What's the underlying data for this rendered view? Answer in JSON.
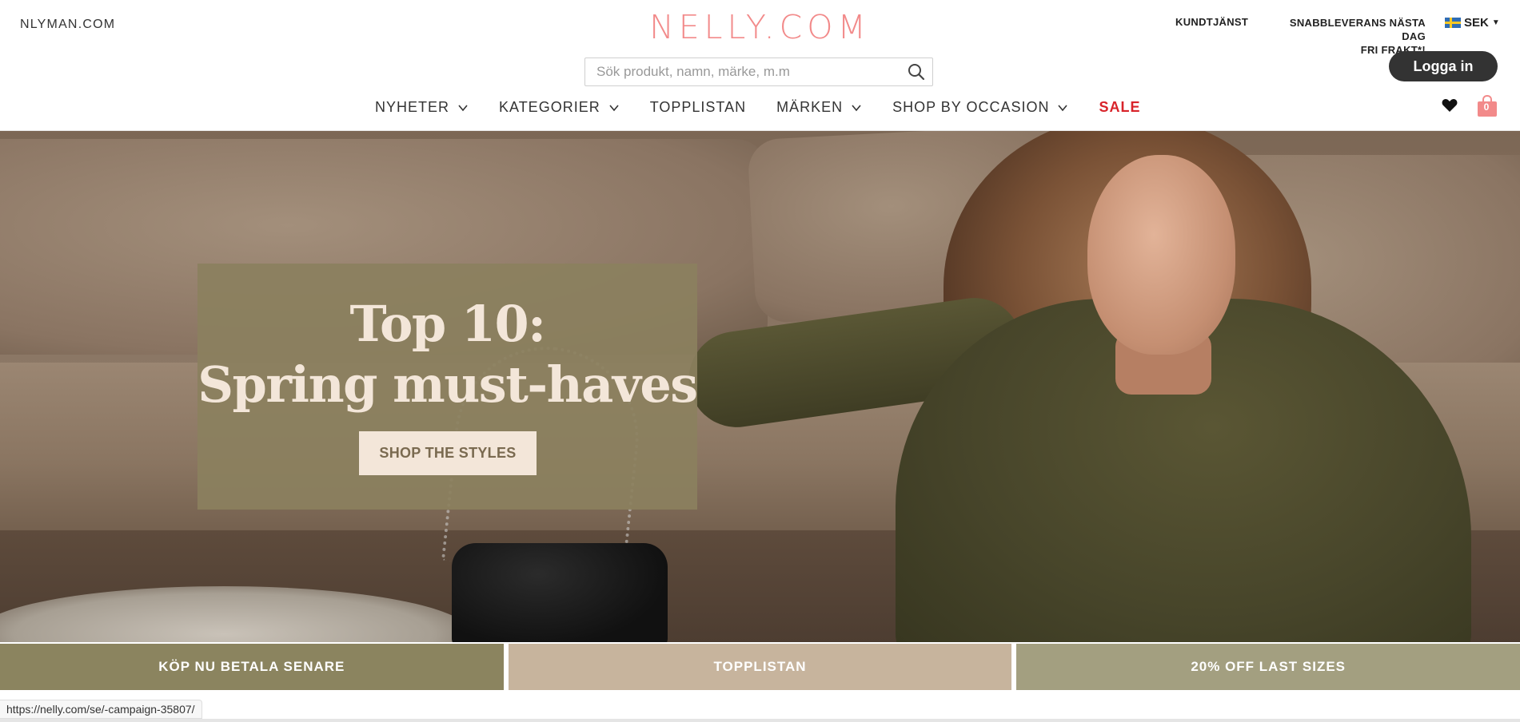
{
  "header": {
    "top_left_link": "NLYMAN.COM",
    "logo": "NELLY.COM",
    "customer_service": "KUNDTJÄNST",
    "delivery_line1": "SNABBLEVERANS NÄSTA DAG",
    "delivery_line2": "FRI FRAKT*!",
    "currency": "SEK",
    "login_label": "Logga in",
    "search_placeholder": "Sök produkt, namn, märke, m.m",
    "bag_count": "0"
  },
  "nav": {
    "items": [
      {
        "label": "NYHETER",
        "has_dropdown": true
      },
      {
        "label": "KATEGORIER",
        "has_dropdown": true
      },
      {
        "label": "TOPPLISTAN",
        "has_dropdown": false
      },
      {
        "label": "MÄRKEN",
        "has_dropdown": true
      },
      {
        "label": "SHOP BY OCCASION",
        "has_dropdown": true
      },
      {
        "label": "SALE",
        "has_dropdown": false
      }
    ]
  },
  "hero": {
    "title_line1": "Top 10:",
    "title_line2": "Spring must-haves",
    "cta_label": "SHOP THE STYLES"
  },
  "tiles": [
    {
      "label": "KÖP NU BETALA SENARE"
    },
    {
      "label": "TOPPLISTAN"
    },
    {
      "label": "20% OFF LAST SIZES"
    }
  ],
  "statusbar": {
    "url": "https://nelly.com/se/-campaign-35807/"
  },
  "colors": {
    "logo": "#f28a8a",
    "sale": "#d8232a",
    "login_bg": "#333333",
    "promo_box": "#8b805e",
    "tile_1": "#8b845f",
    "tile_2": "#c7b49d",
    "tile_3": "#a39f80"
  },
  "icons": [
    "search-icon",
    "chevron-down-icon",
    "heart-icon",
    "shopping-bag-icon",
    "sweden-flag-icon",
    "caret-down-icon"
  ]
}
